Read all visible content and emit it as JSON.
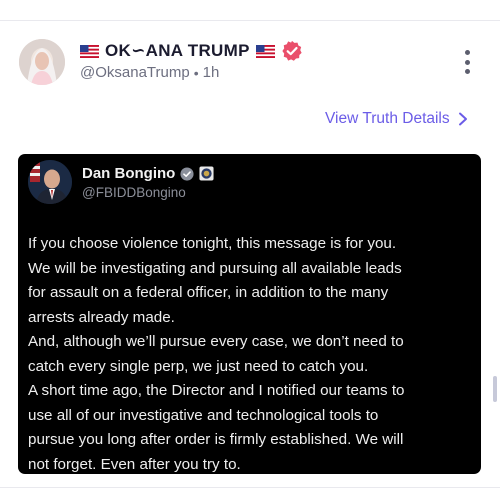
{
  "post": {
    "display_name": "OK∽ANA TRUMP",
    "handle": "@OksanaTrump",
    "separator": "•",
    "time": "1h",
    "view_details_label": "View Truth Details"
  },
  "embedded": {
    "name": "Dan Bongino",
    "handle": "@FBIDDBongino",
    "paragraphs": [
      "If you choose violence tonight, this message is for you.\nWe will be investigating and pursuing all available leads\nfor assault on a federal officer, in addition to the many\narrests already made.",
      "And, although we’ll pursue every case, we don’t need to\ncatch every single perp, we just need to catch you.",
      "A short time ago, the Director and I notified our teams to\nuse all of our investigative and technological tools to\npursue you long after order is firmly established. We will\nnot forget. Even after you try to."
    ]
  },
  "colors": {
    "accent": "#6b5ce7",
    "verified_badge": "#ea4f6b",
    "embed_background": "#000000"
  },
  "icons": [
    "us-flag-icon",
    "verified-badge-icon",
    "more-vertical-icon",
    "chevron-right-icon",
    "x-verified-icon",
    "fbi-seal-icon"
  ]
}
